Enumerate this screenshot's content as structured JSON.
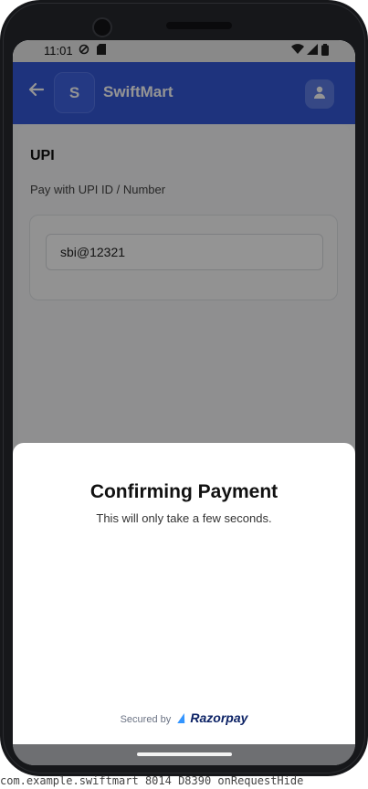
{
  "status_bar": {
    "time": "11:01",
    "icons": [
      "do-not-disturb-icon",
      "sim-card-icon",
      "wifi-icon",
      "signal-icon",
      "battery-icon"
    ]
  },
  "app_bar": {
    "logo_letter": "S",
    "title": "SwiftMart",
    "color": "#3559d8"
  },
  "upi": {
    "title": "UPI",
    "subtitle": "Pay with UPI ID / Number",
    "input_value": "sbi@12321"
  },
  "sheet": {
    "title": "Confirming Payment",
    "subtitle": "This will only take a few seconds.",
    "secured_by": "Secured by",
    "brand": "Razorpay"
  },
  "console_text": "com.example.swiftmart 8014 D8390 onRequestHide"
}
